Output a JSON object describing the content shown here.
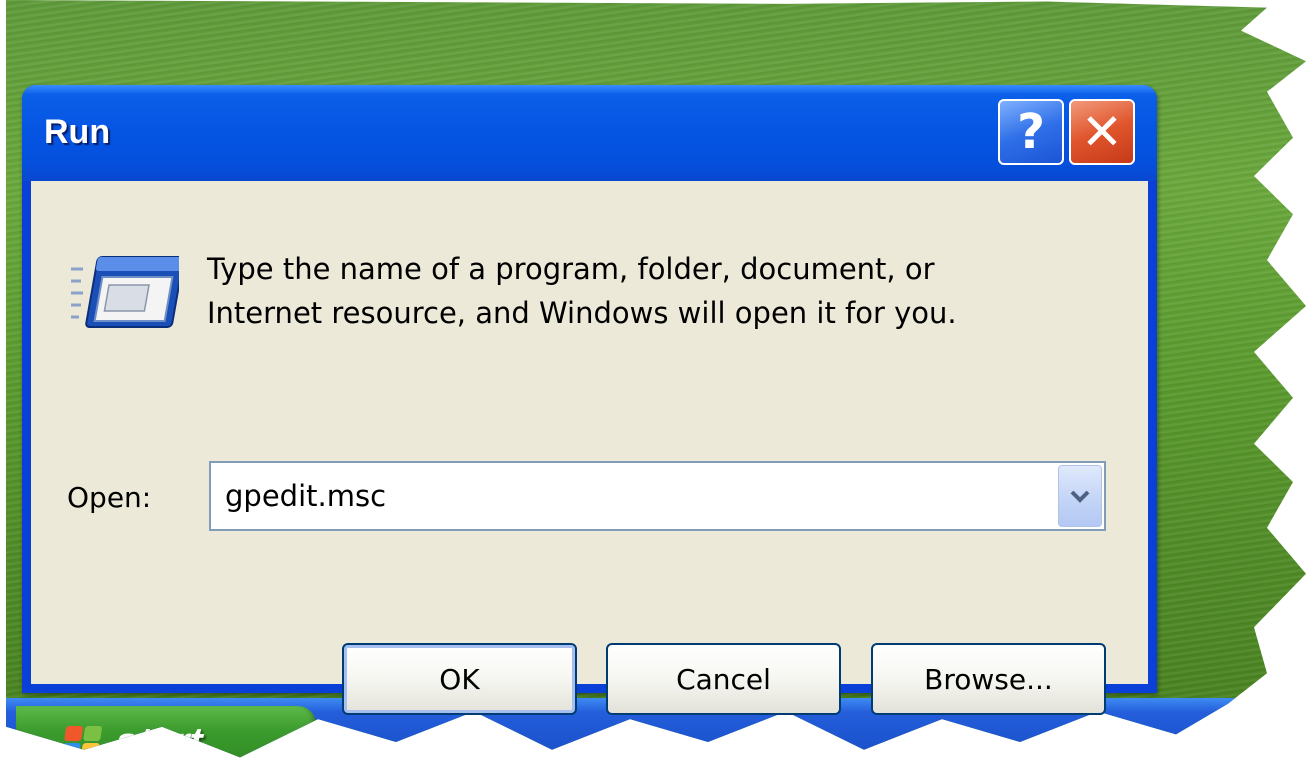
{
  "desktop": {
    "start_label": "start"
  },
  "dialog": {
    "title": "Run",
    "help_glyph": "?",
    "close_glyph": "✕",
    "program_icon": "run-program-icon",
    "message_line1": "Type the name of a program, folder, document, or",
    "message_line2": "Internet resource, and Windows will open it for you.",
    "open_label": "Open:",
    "open_value": "gpedit.msc",
    "buttons": {
      "ok": "OK",
      "cancel": "Cancel",
      "browse": "Browse..."
    }
  },
  "colors": {
    "title_bar": "#0554e2",
    "client_bg": "#ece9d8",
    "close_button": "#e0552c",
    "start_button": "#3c9c2d"
  }
}
